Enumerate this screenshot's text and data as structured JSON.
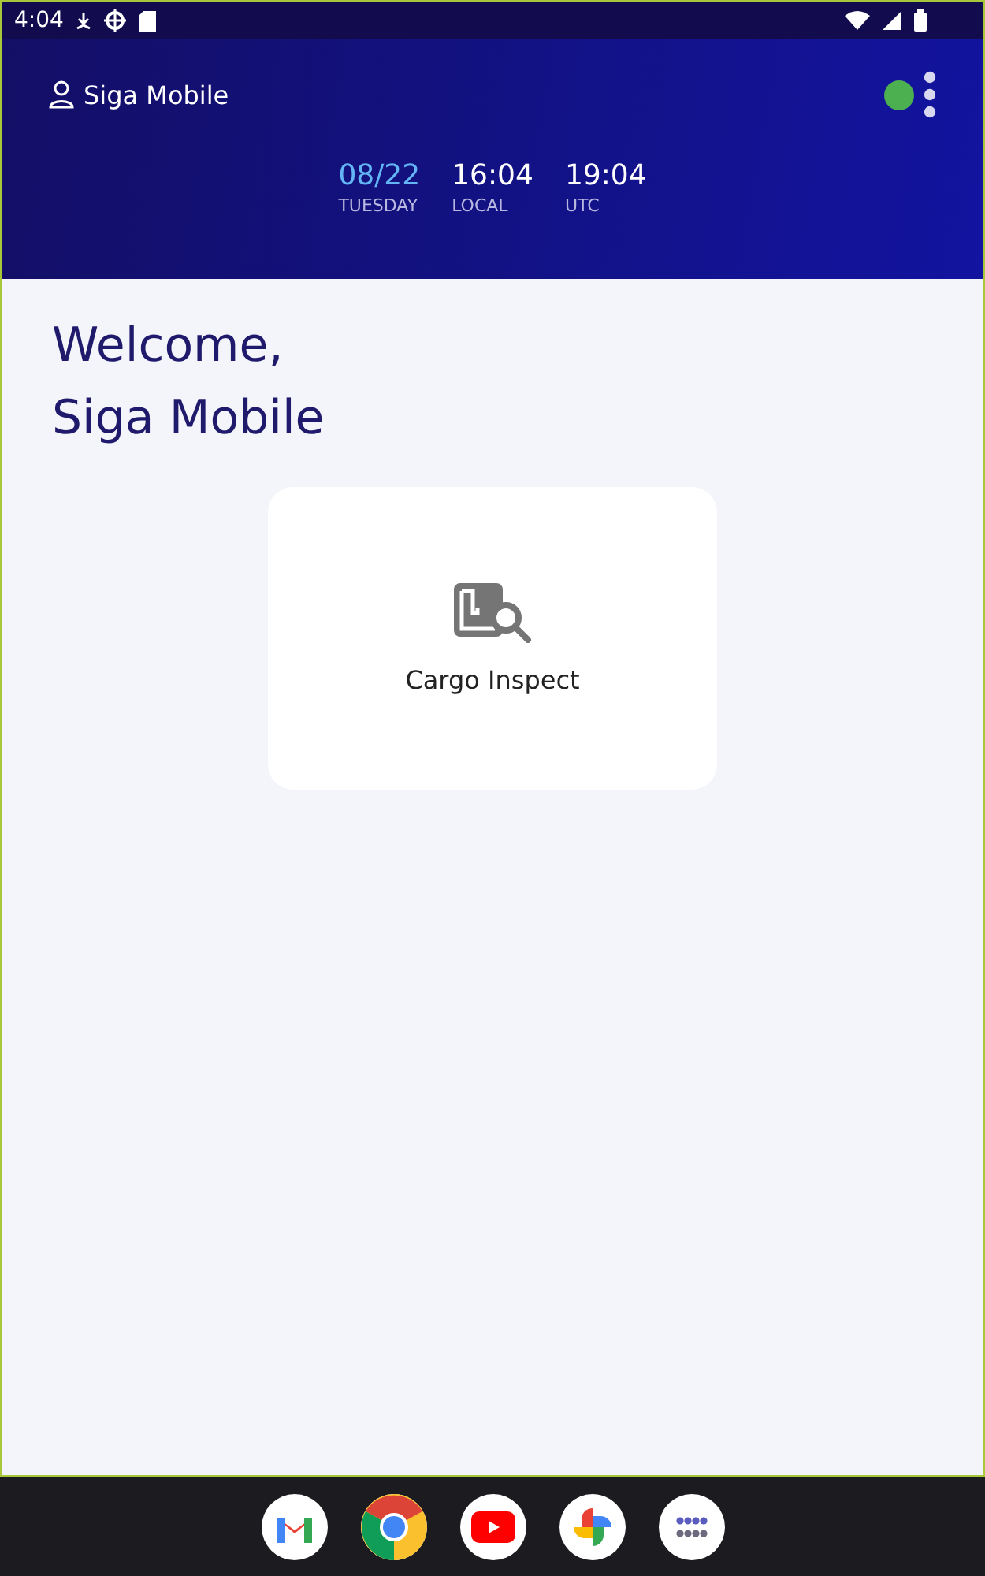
{
  "status_bar": {
    "time": "4:04"
  },
  "header": {
    "user": "Siga Mobile",
    "connection": {
      "color": "#4caf50"
    },
    "clock": [
      {
        "kind": "date",
        "value": "08/22",
        "label": "TUESDAY"
      },
      {
        "kind": "time",
        "value": "16:04",
        "label": "LOCAL"
      },
      {
        "kind": "time",
        "value": "19:04",
        "label": "UTC"
      }
    ]
  },
  "welcome": [
    "Welcome,",
    "Siga Mobile"
  ],
  "apps": [
    {
      "label": "Cargo Inspect"
    }
  ],
  "dock": [
    {
      "kind": "mail"
    },
    {
      "kind": "browser"
    },
    {
      "kind": "video"
    },
    {
      "kind": "photos"
    },
    {
      "kind": "apps"
    }
  ]
}
